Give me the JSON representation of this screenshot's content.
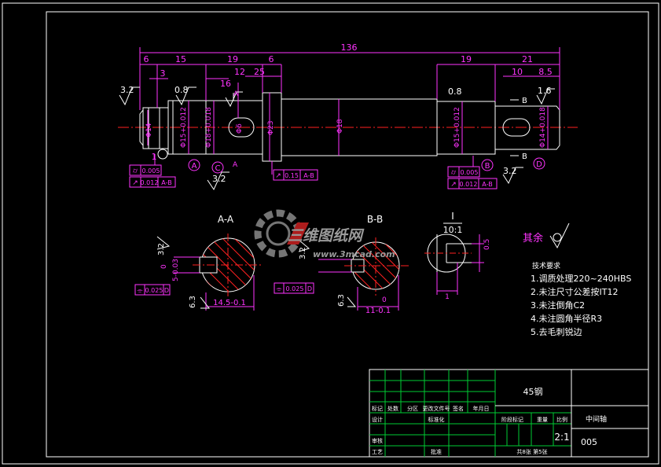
{
  "colors": {
    "background": "#000000",
    "frame": "#ffffff",
    "outline": "#ffffff",
    "dimension": "#ff33ff",
    "centerline": "#ff2020",
    "hatch": "#ff2020",
    "title_grid": "#00cc33",
    "text": "#ffffff",
    "watermark": "#8a8a8a",
    "watermark_accent": "#cc2222"
  },
  "dimensions": {
    "overall": "136",
    "top_left": [
      "6",
      "15",
      "19",
      "6"
    ],
    "top_right": [
      "19",
      "21"
    ],
    "sub": [
      "3",
      "16",
      "12",
      "25",
      "10",
      "8.5"
    ],
    "chamfer_small": "1",
    "roughness": [
      "3.2",
      "0.8",
      "0.8",
      "1.6",
      "3.2",
      "3.2"
    ]
  },
  "diameters": {
    "d14": "Φ14",
    "d15_left": "Φ15+0.012",
    "d18": "Φ18+0.018",
    "d6": "Φ6",
    "d23": "Φ23",
    "d18_mid": "Φ18",
    "d15_right": "Φ15+0.012",
    "d14_right": "Φ14+0.018"
  },
  "tolerance_frames": [
    {
      "symbol": "⌭",
      "value": "0.005",
      "ref": ""
    },
    {
      "symbol": "↗",
      "value": "0.012",
      "ref": "A-B"
    },
    {
      "symbol": "↗",
      "value": "0.15",
      "ref": "A-B"
    },
    {
      "symbol": "⌭",
      "value": "0.005",
      "ref": ""
    },
    {
      "symbol": "↗",
      "value": "0.012",
      "ref": "A-B"
    },
    {
      "symbol": "⌯",
      "value": "0.025",
      "ref": "D"
    },
    {
      "symbol": "⌯",
      "value": "0.025",
      "ref": "D"
    }
  ],
  "datums": [
    "A",
    "C",
    "B",
    "D"
  ],
  "section_markers": {
    "a": "A",
    "b": "B"
  },
  "sections": {
    "aa_title": "A-A",
    "bb_title": "B-B",
    "aa_width": "14.5-0.1",
    "bb_width": "11-0.1",
    "aa_key": "5-0.03",
    "aa_zero": "0",
    "bb_zero": "0",
    "aa_rough": "3.2",
    "aa_rough2": "6.3",
    "bb_rough": "3.2",
    "bb_rough2": "6.3",
    "detail_title": "I",
    "detail_scale": "10:1",
    "detail_dim": "0.5",
    "detail_bottom": "1"
  },
  "rest_symbol": {
    "label": "其余",
    "value": ""
  },
  "tech_notes": {
    "heading": "技术要求",
    "items": [
      "1.调质处理220~240HBS",
      "2.未注尺寸公差按IT12",
      "3.未注倒角C2",
      "4.未注圆角半径R3",
      "5.去毛刺锐边"
    ]
  },
  "title_block": {
    "material": "45钢",
    "part_name": "中间轴",
    "drawing_no": "005",
    "scale": "2:1",
    "sheet": "共8张 第5张",
    "headers": [
      "标记",
      "处数",
      "分区",
      "更改文件号",
      "签名",
      "年月日"
    ],
    "row_labels": [
      "设计",
      "审核",
      "工艺"
    ],
    "mid_labels": [
      "标准化",
      "批准"
    ],
    "right_labels": [
      "阶段标记",
      "重量",
      "比例"
    ]
  },
  "watermark": {
    "brand": "三维网",
    "brand_display": "三维图纸网",
    "url": "www.3mcad.com"
  }
}
